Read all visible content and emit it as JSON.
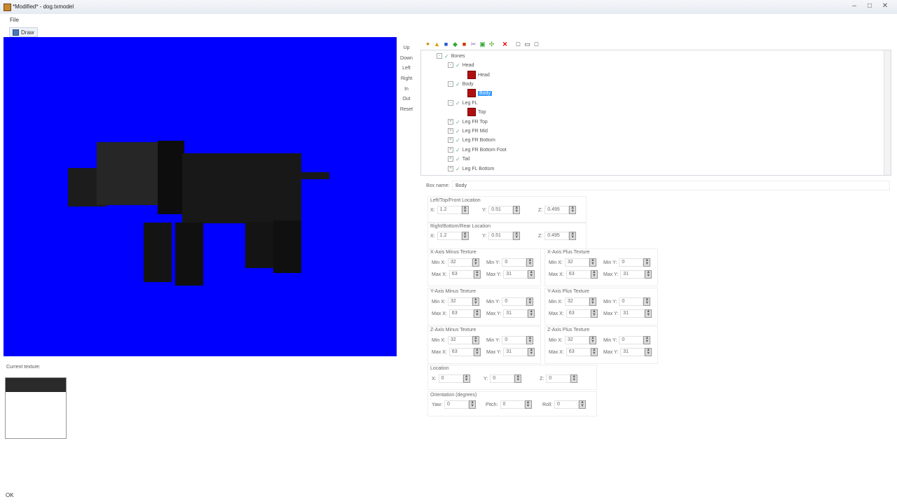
{
  "window": {
    "title": "*Modified* - dog.txmodel"
  },
  "menu": {
    "file": "File"
  },
  "toolbar": {
    "draw": "Draw"
  },
  "view_buttons": [
    "Up",
    "Down",
    "Left",
    "Right",
    "In",
    "Out",
    "Reset"
  ],
  "tree": {
    "nodes": [
      {
        "label": "Bones",
        "level": 0
      },
      {
        "label": "Head",
        "level": 1
      },
      {
        "label": "Head",
        "level": 2,
        "box": true
      },
      {
        "label": "Body",
        "level": 1
      },
      {
        "label": "Body",
        "level": 2,
        "box": true,
        "selected": true
      },
      {
        "label": "Leg FL",
        "level": 1
      },
      {
        "label": "Top",
        "level": 2,
        "box": true
      },
      {
        "label": "Leg FR Top",
        "level": 1
      },
      {
        "label": "Leg FR Mid",
        "level": 1
      },
      {
        "label": "Leg FR Bottom",
        "level": 1
      },
      {
        "label": "Leg FR Bottom Foot",
        "level": 1
      },
      {
        "label": "Tail",
        "level": 1
      },
      {
        "label": "Leg FL Bottom",
        "level": 1
      }
    ]
  },
  "props": {
    "box_name_label": "Box name:",
    "box_name": "Body",
    "ltf": {
      "title": "Left/Top/Front Location",
      "x": "1.2",
      "y": "0.51",
      "z": "0.495"
    },
    "rbr": {
      "title": "Right/Bottom/Rear Location",
      "x": "1.2",
      "y": "0.51",
      "z": "0.495"
    },
    "textures": [
      {
        "title": "X-Axis Minus Texture",
        "minx": "32",
        "miny": "0",
        "maxx": "63",
        "maxy": "31"
      },
      {
        "title": "X-Axis Plus Texture",
        "minx": "32",
        "miny": "0",
        "maxx": "63",
        "maxy": "31"
      },
      {
        "title": "Y-Axis Minus Texture",
        "minx": "32",
        "miny": "0",
        "maxx": "63",
        "maxy": "31"
      },
      {
        "title": "Y-Axis Plus Texture",
        "minx": "32",
        "miny": "0",
        "maxx": "63",
        "maxy": "31"
      },
      {
        "title": "Z-Axis Minus Texture",
        "minx": "32",
        "miny": "0",
        "maxx": "63",
        "maxy": "31"
      },
      {
        "title": "Z-Axis Plus Texture",
        "minx": "32",
        "miny": "0",
        "maxx": "63",
        "maxy": "31"
      }
    ],
    "labels": {
      "minx": "Min X:",
      "miny": "Min Y:",
      "maxx": "Max X:",
      "maxy": "Max Y:",
      "x": "X:",
      "y": "Y:",
      "z": "Z:"
    },
    "location": {
      "title": "Location",
      "x": "0",
      "y": "0",
      "z": "0"
    },
    "orientation": {
      "title": "Orientation (degrees)",
      "yaw_label": "Yaw:",
      "pitch_label": "Pitch:",
      "roll_label": "Roll:",
      "yaw": "0",
      "pitch": "0",
      "roll": "0"
    }
  },
  "texture_panel": {
    "label": "Current texture:"
  },
  "status": {
    "text": "OK"
  },
  "colors": {
    "viewport_bg": "#0000fe",
    "selection": "#3399ff",
    "bone_box": "#b01010"
  }
}
